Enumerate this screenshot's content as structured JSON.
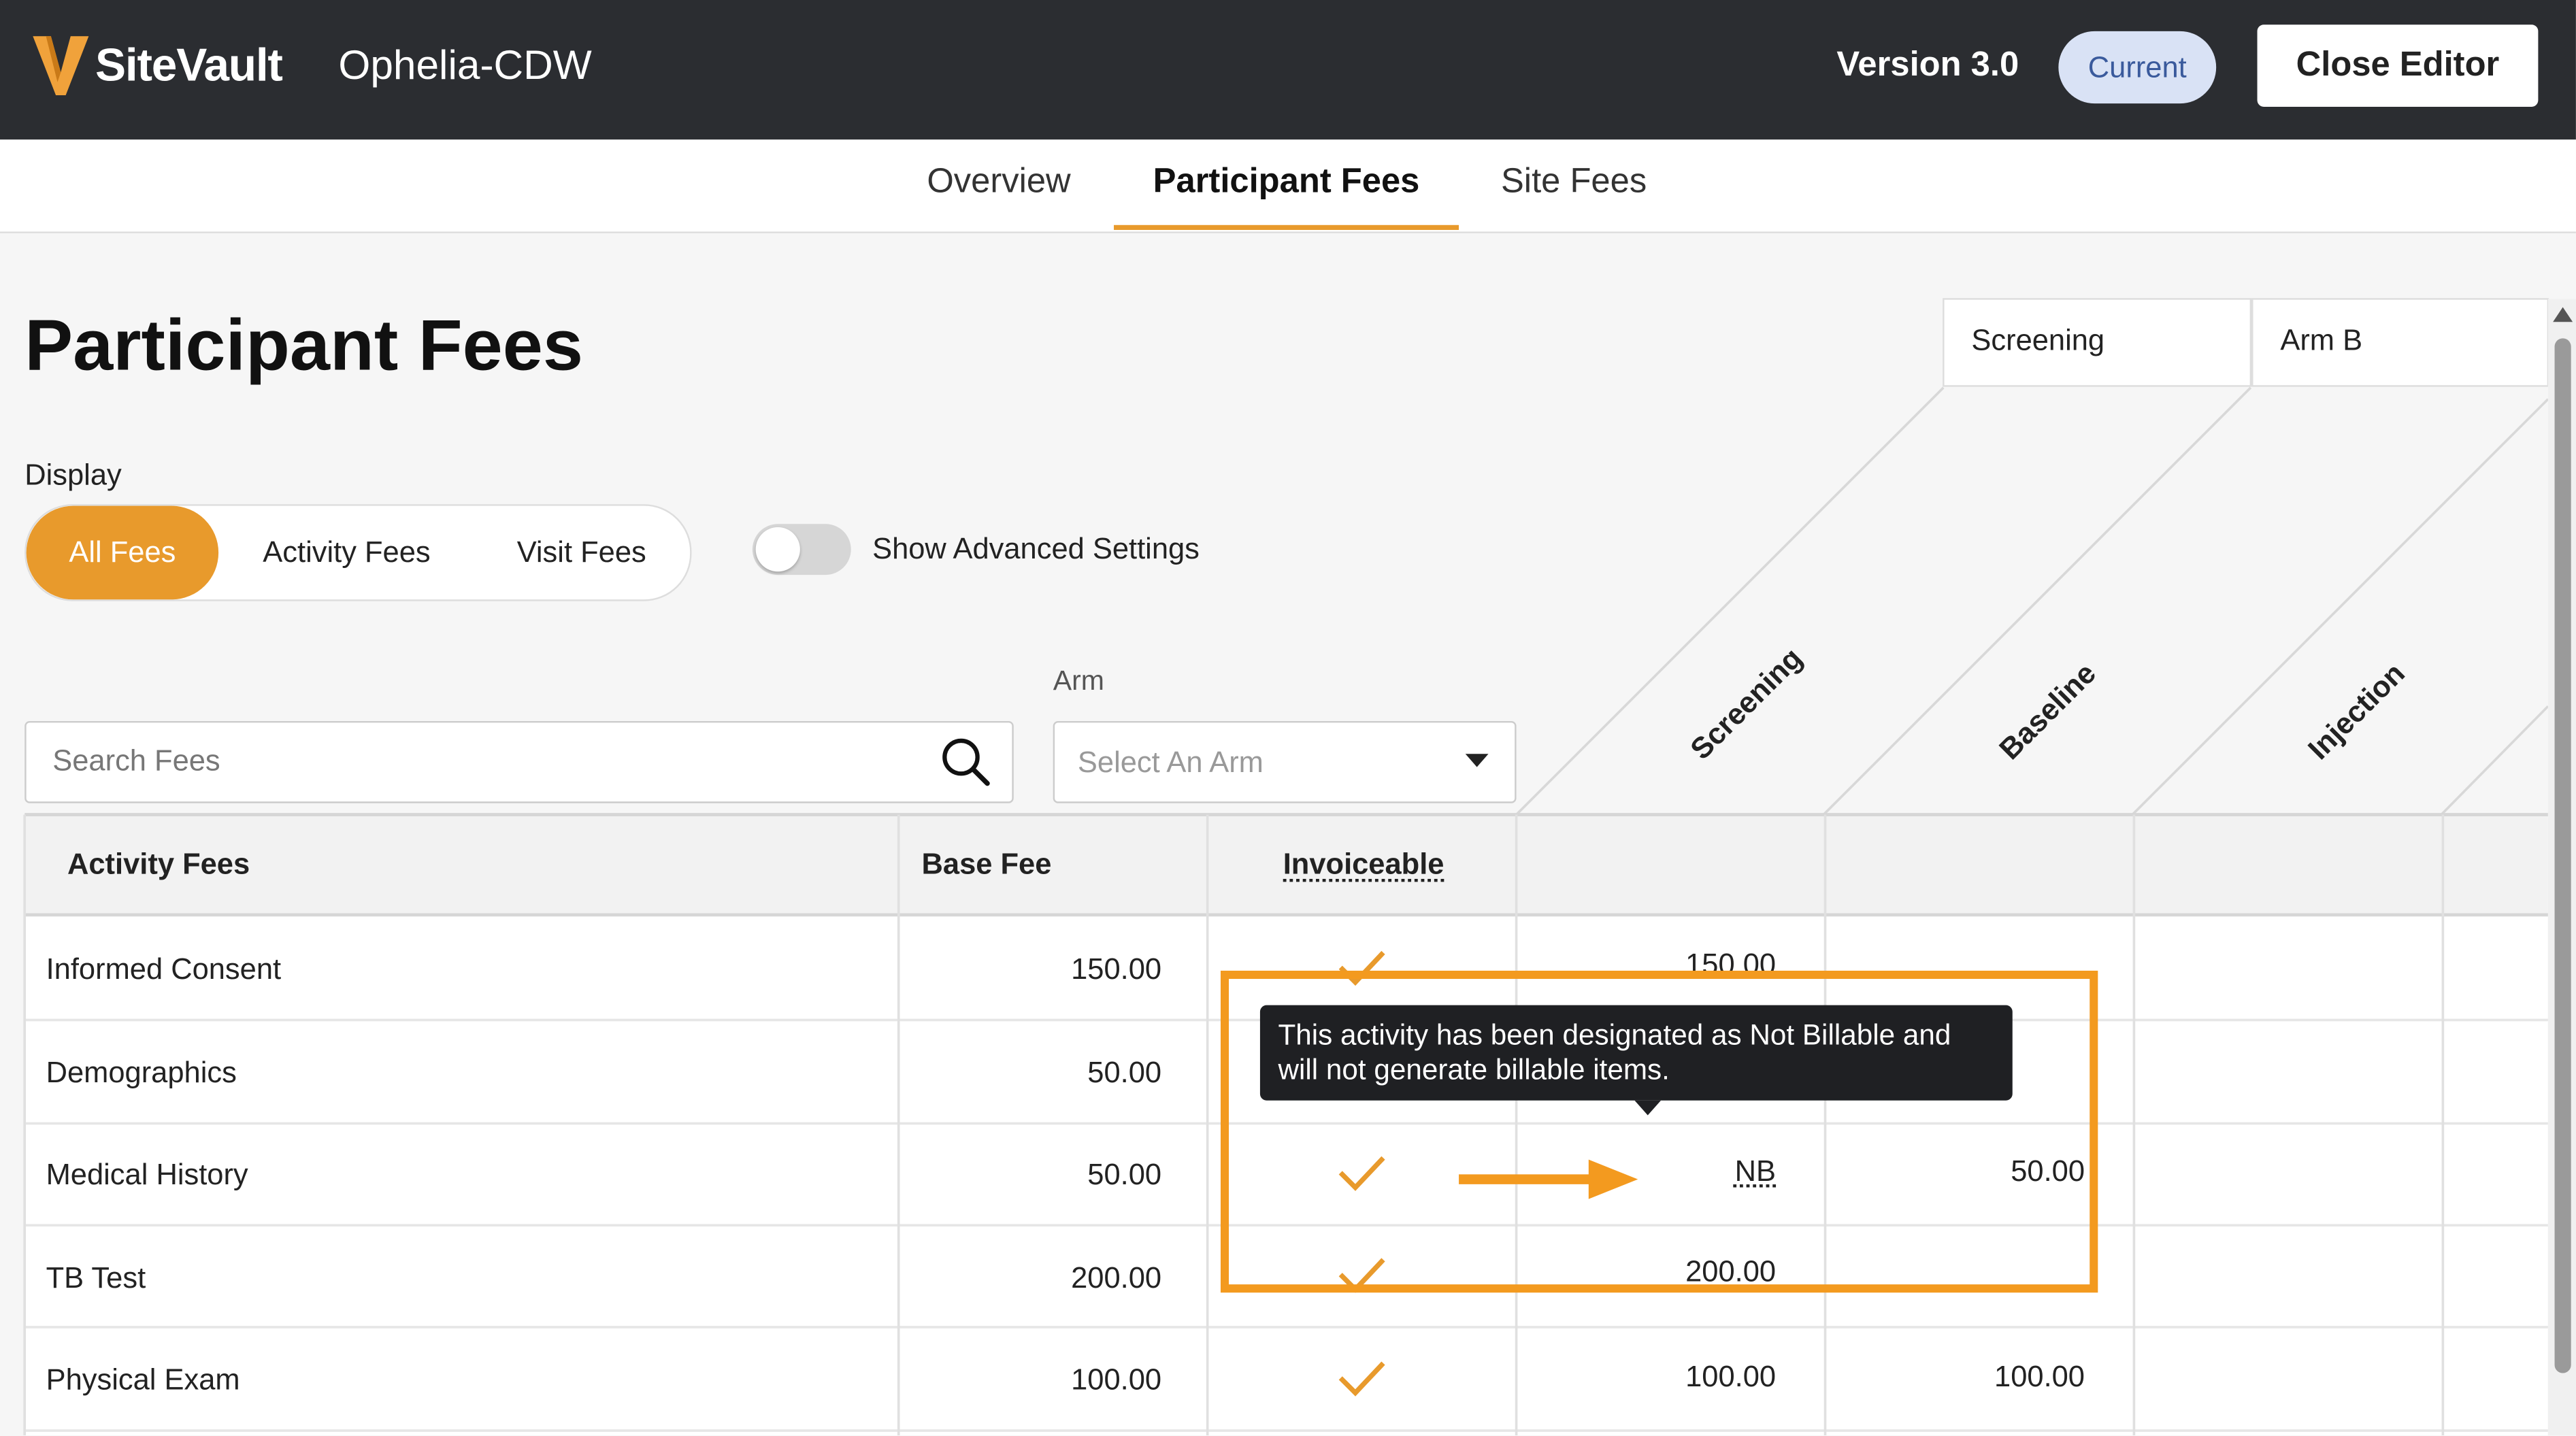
{
  "header": {
    "brand": "SiteVault",
    "study_name": "Ophelia-CDW",
    "version": "Version 3.0",
    "status_badge": "Current",
    "close_button": "Close Editor"
  },
  "tabs": [
    {
      "label": "Overview",
      "active": false
    },
    {
      "label": "Participant Fees",
      "active": true
    },
    {
      "label": "Site Fees",
      "active": false
    }
  ],
  "page": {
    "title": "Participant Fees",
    "display_label": "Display",
    "display_options": [
      {
        "label": "All Fees",
        "active": true
      },
      {
        "label": "Activity Fees",
        "active": false
      },
      {
        "label": "Visit Fees",
        "active": false
      }
    ],
    "advanced_settings_label": "Show Advanced Settings",
    "advanced_settings_on": false,
    "search_placeholder": "Search Fees",
    "arm_label": "Arm",
    "arm_placeholder": "Select An Arm"
  },
  "visit_headers": {
    "epoch": "Screening",
    "arm": "Arm B",
    "visits": [
      "Screening",
      "Baseline",
      "Injection"
    ]
  },
  "table": {
    "columns": [
      "Activity Fees",
      "Base Fee",
      "Invoiceable"
    ],
    "rows": [
      {
        "name": "Informed Consent",
        "base_fee": "150.00",
        "invoiceable": true,
        "screening": "150.00",
        "baseline": ""
      },
      {
        "name": "Demographics",
        "base_fee": "50.00",
        "invoiceable": true,
        "screening": "",
        "baseline": ""
      },
      {
        "name": "Medical History",
        "base_fee": "50.00",
        "invoiceable": true,
        "screening": "NB",
        "baseline": "50.00"
      },
      {
        "name": "TB Test",
        "base_fee": "200.00",
        "invoiceable": true,
        "screening": "200.00",
        "baseline": ""
      },
      {
        "name": "Physical Exam",
        "base_fee": "100.00",
        "invoiceable": true,
        "screening": "100.00",
        "baseline": "100.00"
      }
    ]
  },
  "tooltip": {
    "line1": "This activity has been designated as Not Billable and",
    "line2": "will not generate billable items."
  },
  "colors": {
    "accent": "#e89a2c",
    "highlight": "#f39a1f",
    "topbar": "#2b2d31",
    "badge_bg": "#d9e2f5"
  }
}
